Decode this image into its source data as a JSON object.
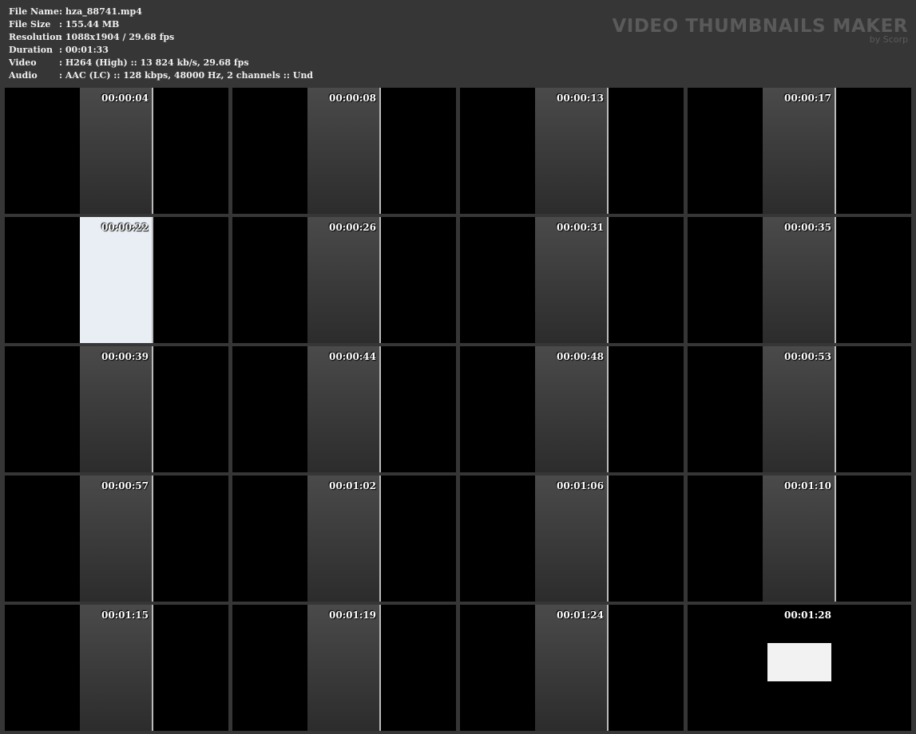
{
  "info": [
    {
      "label": "File Name",
      "value": "hza_88741.mp4"
    },
    {
      "label": "File Size",
      "value": "155.44 MB"
    },
    {
      "label": "Resolution",
      "value": "1088x1904 / 29.68 fps"
    },
    {
      "label": "Duration",
      "value": "00:01:33"
    },
    {
      "label": "Video",
      "value": "H264 (High) :: 13 824 kb/s, 29.68 fps"
    },
    {
      "label": "Audio",
      "value": "AAC (LC) :: 128 kbps, 48000 Hz, 2 channels :: Und"
    }
  ],
  "brand": {
    "title": "VIDEO THUMBNAILS MAKER",
    "subtitle": "by Scorp"
  },
  "thumbnails": [
    "00:00:04",
    "00:00:08",
    "00:00:13",
    "00:00:17",
    "00:00:22",
    "00:00:26",
    "00:00:31",
    "00:00:35",
    "00:00:39",
    "00:00:44",
    "00:00:48",
    "00:00:53",
    "00:00:57",
    "00:01:02",
    "00:01:06",
    "00:01:10",
    "00:01:15",
    "00:01:19",
    "00:01:24",
    "00:01:28"
  ]
}
